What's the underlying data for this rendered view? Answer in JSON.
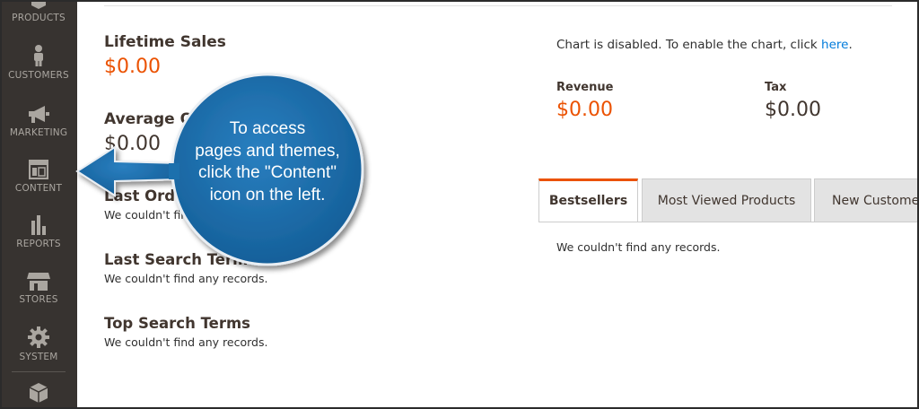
{
  "sidebar": {
    "items": [
      {
        "label": "PRODUCTS",
        "icon": "products-icon"
      },
      {
        "label": "CUSTOMERS",
        "icon": "customers-icon"
      },
      {
        "label": "MARKETING",
        "icon": "marketing-icon"
      },
      {
        "label": "CONTENT",
        "icon": "content-icon"
      },
      {
        "label": "REPORTS",
        "icon": "reports-icon"
      },
      {
        "label": "STORES",
        "icon": "stores-icon"
      },
      {
        "label": "SYSTEM",
        "icon": "system-icon"
      },
      {
        "label": "",
        "icon": "extensions-icon"
      }
    ]
  },
  "dashboard": {
    "lifetime_sales": {
      "label": "Lifetime Sales",
      "value": "$0.00"
    },
    "average_order": {
      "label": "Average Order",
      "value": "$0.00"
    },
    "last_orders": {
      "label": "Last Orders",
      "note": "We couldn't find any records."
    },
    "last_search_terms": {
      "label": "Last Search Terms",
      "note": "We couldn't find any records."
    },
    "top_search_terms": {
      "label": "Top Search Terms",
      "note": "We couldn't find any records."
    }
  },
  "chart": {
    "message": "Chart is disabled. To enable the chart, click ",
    "link": "here",
    "message_end": "."
  },
  "metrics": {
    "revenue": {
      "label": "Revenue",
      "value": "$0.00"
    },
    "tax": {
      "label": "Tax",
      "value": "$0.00"
    }
  },
  "tabs": {
    "items": [
      "Bestsellers",
      "Most Viewed Products",
      "New Customers"
    ],
    "active": "Bestsellers",
    "empty_note": "We couldn't find any records."
  },
  "callout": {
    "lines": [
      "To access",
      "pages and themes,",
      "click the \"Content\"",
      "icon on the left."
    ]
  },
  "colors": {
    "sidebar_bg": "#373330",
    "accent_orange": "#eb5202",
    "callout_blue": "#1a6aa6",
    "link_blue": "#007bdb"
  }
}
